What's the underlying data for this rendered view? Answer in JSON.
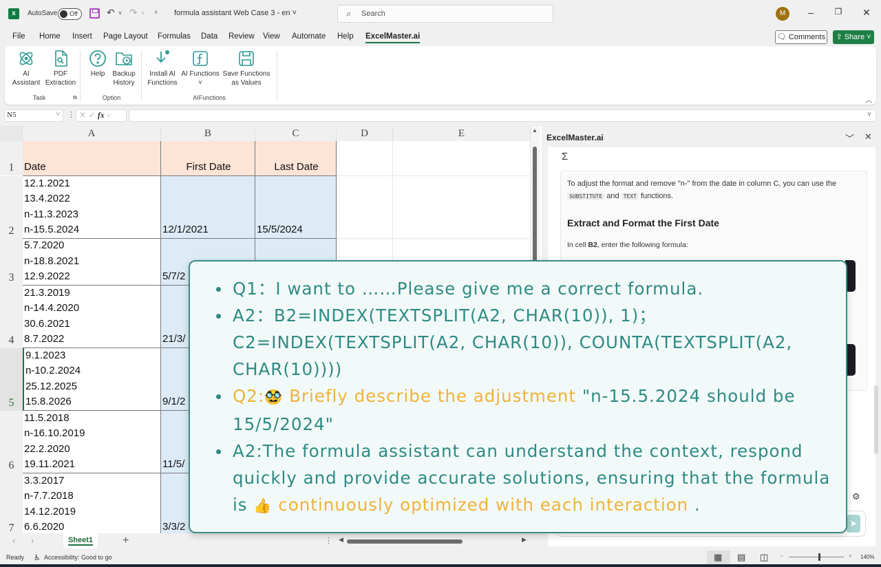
{
  "titlebar": {
    "app_icon": "excel-icon",
    "autosave_label": "AutoSave",
    "autosave_state": "Off",
    "document_title": "formula assistant Web Case 3 - en",
    "search_placeholder": "Search",
    "avatar_initial": "M"
  },
  "menu": {
    "items": [
      "File",
      "Home",
      "Insert",
      "Page Layout",
      "Formulas",
      "Data",
      "Review",
      "View",
      "Automate",
      "Help",
      "ExcelMaster.ai"
    ],
    "active": "ExcelMaster.ai",
    "comments_label": "Comments",
    "share_label": "Share"
  },
  "ribbon": {
    "groups": [
      {
        "name": "Task",
        "buttons": [
          {
            "line1": "AI",
            "line2": "Assistant"
          },
          {
            "line1": "PDF",
            "line2": "Extraction"
          }
        ]
      },
      {
        "name": "Option",
        "buttons": [
          {
            "line1": "Help",
            "line2": ""
          },
          {
            "line1": "Backup",
            "line2": "History"
          }
        ]
      },
      {
        "name": "AIFunctions",
        "buttons": [
          {
            "line1": "Install AI",
            "line2": "Functions"
          },
          {
            "line1": "AI Functions",
            "line2": "˅"
          },
          {
            "line1": "Save Functions",
            "line2": "as Values"
          }
        ]
      }
    ]
  },
  "formula_bar": {
    "name_box": "N5",
    "fx_label": "fx",
    "formula": ""
  },
  "sheet": {
    "columns": [
      "A",
      "B",
      "C",
      "D",
      "E"
    ],
    "header_row": {
      "row": "1",
      "A": "Date",
      "B": "First Date",
      "C": "Last  Date"
    },
    "rows": [
      {
        "row": "2",
        "A": [
          "12.1.2021",
          "13.4.2022",
          "n-11.3.2023",
          "n-15.5.2024"
        ],
        "B": "12/1/2021",
        "C": "15/5/2024"
      },
      {
        "row": "3",
        "A": [
          "5.7.2020",
          "n-18.8.2021",
          "12.9.2022"
        ],
        "B": "5/7/2",
        "C": ""
      },
      {
        "row": "4",
        "A": [
          "21.3.2019",
          "n-14.4.2020",
          "30.6.2021",
          "8.7.2022"
        ],
        "B": "21/3/",
        "C": ""
      },
      {
        "row": "5",
        "A": [
          "9.1.2023",
          "n-10.2.2024",
          "25.12.2025",
          "15.8.2026"
        ],
        "B": "9/1/2",
        "C": ""
      },
      {
        "row": "6",
        "A": [
          "11.5.2018",
          "n-16.10.2019",
          "22.2.2020",
          "19.11.2021"
        ],
        "B": "11/5/",
        "C": ""
      },
      {
        "row": "7",
        "A": [
          "3.3.2017",
          "n-7.7.2018",
          "14.12.2019",
          "6.6.2020"
        ],
        "B": "3/3/2",
        "C": ""
      }
    ],
    "tabs": [
      "Sheet1"
    ],
    "colors": {
      "header_fill": "#fce4d6",
      "result_fill": "#ddebf7"
    }
  },
  "panel": {
    "title": "ExcelMaster.ai",
    "sigma": "Σ",
    "message_intro": "To adjust the format and remove \"n-\" from the date in column C, you can use the",
    "code1": "SUBSTITUTE",
    "and": "and",
    "code2": "TEXT",
    "functions": "functions.",
    "heading": "Extract and Format the First Date",
    "cell_prefix": "In cell ",
    "cell_ref": "B2",
    "cell_suffix": ", enter the following formula:"
  },
  "callout": {
    "q1": "Q1：I want to ……Please give me a correct formula.",
    "a1_line1": "A2：B2=INDEX(TEXTSPLIT(A2, CHAR(10)), 1)；",
    "a1_line2": "C2=INDEX(TEXTSPLIT(A2, CHAR(10)), COUNTA(TEXTSPLIT(A2, CHAR(10))))",
    "q2_prefix": "Q2:",
    "q2_emoji": "🥸",
    "q2_text": " Briefly describe the adjustment ",
    "q2_quote": "\"n-15.5.2024 should be 15/5/2024\"",
    "a2_text": "A2:The formula assistant can understand the context, respond quickly and provide accurate solutions, ensuring that the formula is ",
    "a2_emoji": "👍",
    "a2_highlight": " continuously optimized with each interaction ",
    "a2_end": ".",
    "colors": {
      "teal": "#2e8a84",
      "orange": "#f0b23a",
      "background": "#f2faf9"
    }
  },
  "status": {
    "ready": "Ready",
    "accessibility": "Accessibility: Good to go",
    "zoom": "140%"
  }
}
